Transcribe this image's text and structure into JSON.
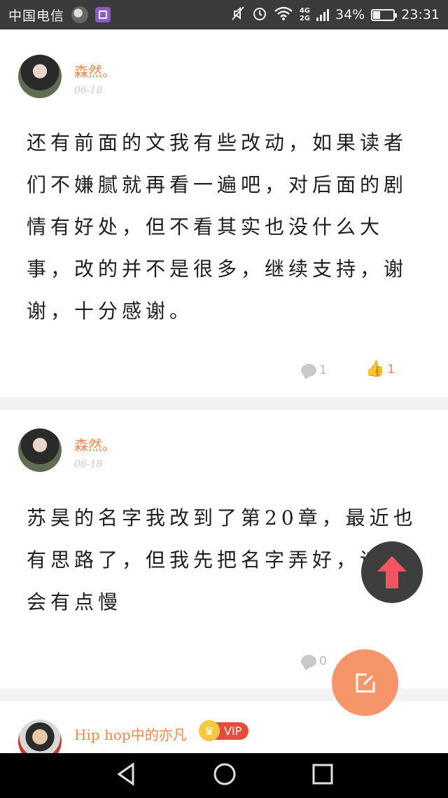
{
  "status_bar": {
    "carrier": "中国电信",
    "network_top": "4G",
    "network_bottom": "2G",
    "battery_percent": "34%",
    "battery_level": 0.34,
    "time": "23:31",
    "icons": [
      "avatar-app-icon",
      "gallery-app-icon",
      "mute-icon",
      "alarm-icon",
      "wifi-icon",
      "signal-icon",
      "battery-icon"
    ]
  },
  "comments": [
    {
      "username": "森然。",
      "date": "06-18",
      "content": "还有前面的文我有些改动，如果读者们不嫌腻就再看一遍吧，对后面的剧情有好处，但不看其实也没什么大事，改的并不是很多，继续支持，谢谢，十分感谢。",
      "reply_count": "1",
      "like_count": "1",
      "liked": true
    },
    {
      "username": "森然。",
      "date": "06-18",
      "content": "苏昊的名字我改到了第20章，最近也有思路了，但我先把名字弄好，谅，会有点慢",
      "reply_count": "0"
    },
    {
      "username": "Hip hop中的亦凡",
      "badge": "VIP"
    }
  ],
  "colors": {
    "accent": "#f5864d",
    "fab_edit": "#f7956a",
    "fab_up": "#3e3e3e",
    "arrow": "#f0565f",
    "vip_red": "#e64b3c"
  }
}
